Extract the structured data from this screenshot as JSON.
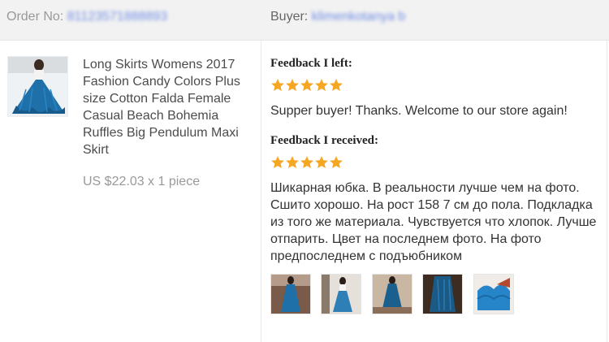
{
  "header": {
    "order_label": "Order No:",
    "order_value": "81123571888893",
    "buyer_label": "Buyer:",
    "buyer_value": "klimenkotanya b"
  },
  "product": {
    "title": "Long Skirts Womens 2017 Fashion Candy Colors Plus size Cotton Falda Female Casual Beach Bohemia Ruffles Big Pendulum Maxi Skirt",
    "price": "US $22.03 x 1 piece",
    "thumbnail_icon": "skirt-photo"
  },
  "feedback_left": {
    "heading": "Feedback I left:",
    "stars": 5,
    "text": "Supper buyer! Thanks. Welcome to our store again!"
  },
  "feedback_received": {
    "heading": "Feedback I received:",
    "stars": 5,
    "text": "Шикарная юбка. В реальности лучше чем на фото. Сшито хорошо. На рост 158 7 см до пола. Подкладка из того же материала. Чувствуется что хлопок. Лучше отпарить. Цвет на последнем фото. На фото предпоследнем с подъюбником",
    "photo_icons": [
      "skirt-photo-1",
      "skirt-photo-2",
      "skirt-photo-3",
      "skirt-photo-4",
      "skirt-photo-5"
    ]
  },
  "colors": {
    "star": "#f5a623",
    "header_bg": "#f2f2f2",
    "skirt_blue": "#1f6fa8",
    "blur_text": "#6f8de6"
  }
}
